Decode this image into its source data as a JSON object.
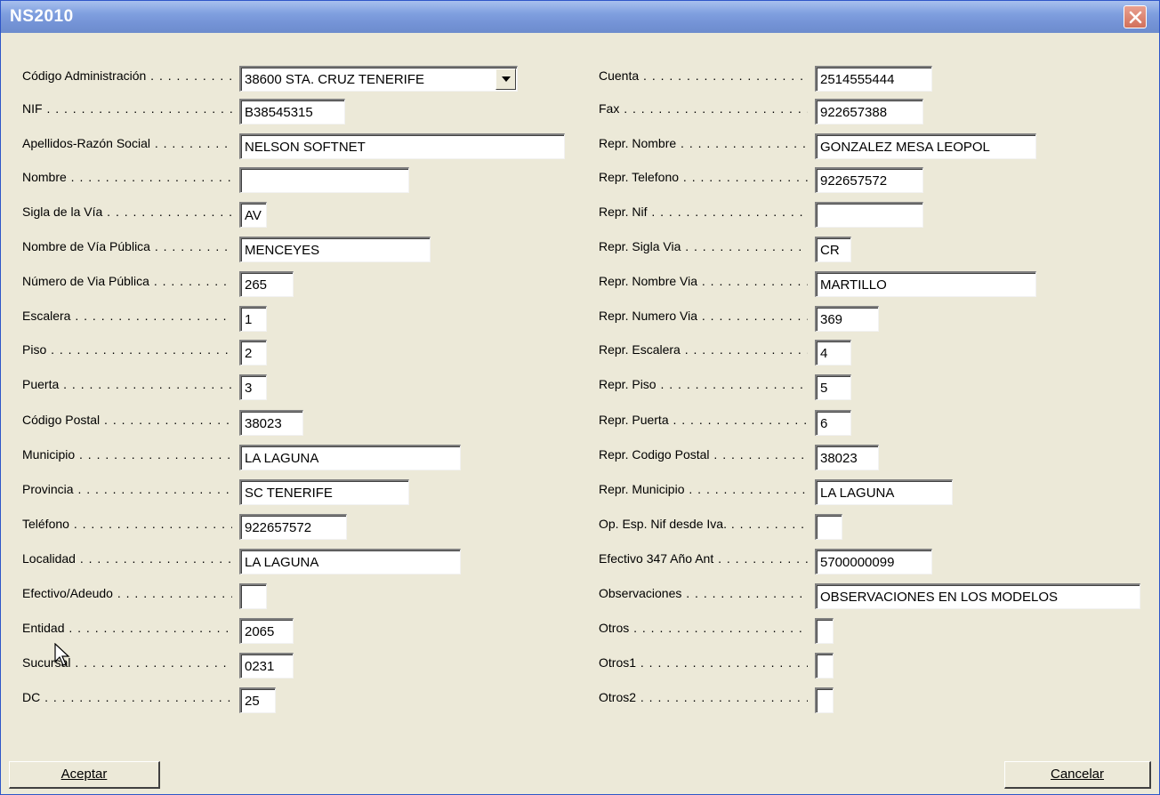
{
  "window": {
    "title": "NS2010"
  },
  "left_fields": [
    {
      "label": "Código Administración",
      "value": "38600 STA. CRUZ TENERIFE"
    },
    {
      "label": "NIF",
      "value": "B38545315"
    },
    {
      "label": "Apellidos-Razón Social",
      "value": "NELSON SOFTNET"
    },
    {
      "label": "Nombre",
      "value": ""
    },
    {
      "label": "Sigla de la Vía",
      "value": "AV"
    },
    {
      "label": "Nombre de Vía Pública",
      "value": "MENCEYES"
    },
    {
      "label": "Número de Via Pública",
      "value": "265"
    },
    {
      "label": "Escalera",
      "value": "1"
    },
    {
      "label": "Piso",
      "value": "2"
    },
    {
      "label": "Puerta",
      "value": "3"
    },
    {
      "label": "Código Postal",
      "value": "38023"
    },
    {
      "label": "Municipio",
      "value": "LA LAGUNA"
    },
    {
      "label": "Provincia",
      "value": "SC TENERIFE"
    },
    {
      "label": "Teléfono",
      "value": "922657572"
    },
    {
      "label": "Localidad",
      "value": "LA LAGUNA"
    },
    {
      "label": "Efectivo/Adeudo",
      "value": ""
    },
    {
      "label": "Entidad",
      "value": "2065"
    },
    {
      "label": "Sucursal",
      "value": "0231"
    },
    {
      "label": "DC",
      "value": "25"
    }
  ],
  "right_fields": [
    {
      "label": "Cuenta",
      "value": "2514555444"
    },
    {
      "label": "Fax",
      "value": "922657388"
    },
    {
      "label": "Repr. Nombre",
      "value": "GONZALEZ MESA LEOPOL"
    },
    {
      "label": "Repr. Telefono",
      "value": "922657572"
    },
    {
      "label": "Repr. Nif",
      "value": ""
    },
    {
      "label": "Repr. Sigla Via",
      "value": "CR"
    },
    {
      "label": "Repr. Nombre Via",
      "value": "MARTILLO"
    },
    {
      "label": "Repr. Numero Via",
      "value": "369"
    },
    {
      "label": "Repr. Escalera",
      "value": "4"
    },
    {
      "label": "Repr. Piso",
      "value": "5"
    },
    {
      "label": "Repr. Puerta",
      "value": "6"
    },
    {
      "label": "Repr. Codigo Postal",
      "value": "38023"
    },
    {
      "label": "Repr. Municipio",
      "value": "LA LAGUNA"
    },
    {
      "label": "Op. Esp. Nif desde Iva.",
      "value": ""
    },
    {
      "label": "Efectivo 347 Año Ant",
      "value": "5700000099"
    },
    {
      "label": "Observaciones",
      "value": "OBSERVACIONES EN LOS MODELOS"
    },
    {
      "label": "Otros",
      "value": ""
    },
    {
      "label": "Otros1",
      "value": ""
    },
    {
      "label": "Otros2",
      "value": ""
    }
  ],
  "buttons": {
    "accept": "Aceptar",
    "cancel": "Cancelar"
  },
  "icons": {
    "close": "close-icon",
    "dropdown": "dropdown-arrow-icon",
    "cursor": "mouse-pointer-icon"
  }
}
